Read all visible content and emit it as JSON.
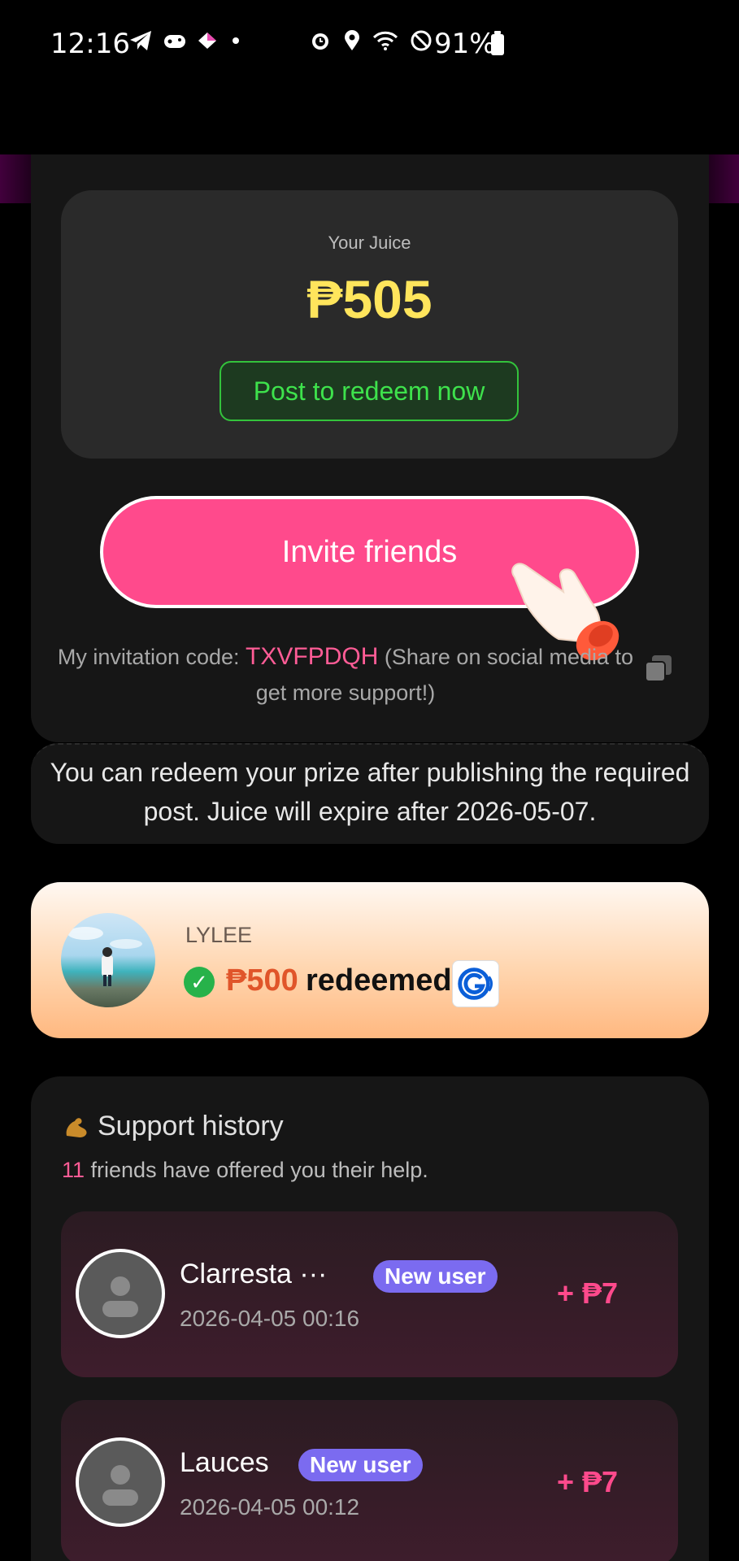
{
  "status_bar": {
    "time": "12:16",
    "battery": "91%",
    "left_icons": [
      "telegram-icon",
      "game-controller-icon",
      "diamond-app-icon",
      "dot-icon"
    ],
    "right_icons": [
      "alarm-icon",
      "location-icon",
      "wifi-icon",
      "dnd-icon",
      "battery-icon"
    ]
  },
  "juice": {
    "label": "Your Juice",
    "amount": "₱505",
    "redeem_label": "Post to redeem now"
  },
  "invite": {
    "button_label": "Invite friends",
    "code_prefix": "My invitation code: ",
    "code": "TXVFPDQH",
    "code_suffix": " (Share on social media to get more support!)"
  },
  "notice": {
    "text": "You can redeem your prize after publishing the required post. Juice will expire after 2026-05-07."
  },
  "redeem_banner": {
    "username": "LYLEE",
    "amount": "₱500",
    "text": "redeemed"
  },
  "support_history": {
    "title": "Support history",
    "count": "11",
    "subtitle": " friends have offered you their help.",
    "entries": [
      {
        "name": "Clarresta ···",
        "badge": "New user",
        "date": "2026-04-05 00:16",
        "reward": "+ ₱7"
      },
      {
        "name": "Lauces",
        "badge": "New user",
        "date": "2026-04-05 00:12",
        "reward": "+ ₱7"
      }
    ]
  },
  "colors": {
    "accent_pink": "#ff4a8c",
    "juice_yellow": "#ffe55c",
    "redeem_green": "#3ee24c",
    "badge_purple": "#7b6bf0"
  }
}
